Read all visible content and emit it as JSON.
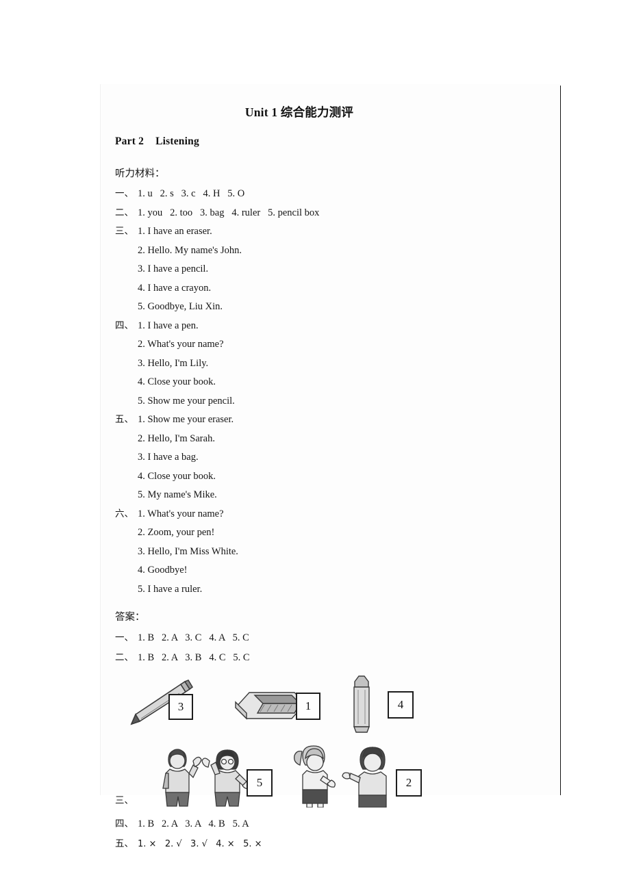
{
  "document": {
    "title": "Unit 1 综合能力测评",
    "part_heading_left": "Part 2",
    "part_heading_right": "Listening",
    "listening_label": "听力材料：",
    "answer_label": "答案："
  },
  "listening": {
    "section1": {
      "marker": "一、",
      "text": "1. u   2. s   3. c   4. H   5. O"
    },
    "section2": {
      "marker": "二、",
      "text": "1. you   2. too   3. bag   4. ruler   5. pencil box"
    },
    "section3": {
      "marker": "三、",
      "items": [
        "1. I have an eraser.",
        "2. Hello. My name's John.",
        "3. I have a pencil.",
        "4. I have a crayon.",
        "5. Goodbye, Liu Xin."
      ]
    },
    "section4": {
      "marker": "四、",
      "items": [
        "1. I have a pen.",
        "2. What's your name?",
        "3. Hello, I'm Lily.",
        "4. Close your book.",
        "5. Show me your pencil."
      ]
    },
    "section5": {
      "marker": "五、",
      "items": [
        "1. Show me your eraser.",
        "2. Hello, I'm Sarah.",
        "3. I have a bag.",
        "4. Close your book.",
        "5. My name's Mike."
      ]
    },
    "section6": {
      "marker": "六、",
      "items": [
        "1. What's your name?",
        "2. Zoom, your pen!",
        "3. Hello, I'm Miss White.",
        "4. Goodbye!",
        "5. I have a ruler."
      ]
    }
  },
  "answers": {
    "section1": {
      "marker": "一、",
      "text": "1. B   2. A   3. C   4. A   5. C"
    },
    "section2": {
      "marker": "二、",
      "text": "1. B   2. A   3. B   4. C   5. C"
    },
    "section3": {
      "marker": "三、",
      "pictures": [
        {
          "id": "pencil",
          "icon": "pencil-icon",
          "box_number": "3"
        },
        {
          "id": "eraser",
          "icon": "eraser-icon",
          "box_number": "1"
        },
        {
          "id": "crayon",
          "icon": "crayon-icon",
          "box_number": "4"
        },
        {
          "id": "two-kids-waving",
          "icon": "children-waving-icon",
          "box_number": "5"
        },
        {
          "id": "girl-and-boy-greeting",
          "icon": "children-greeting-icon",
          "box_number": "2"
        }
      ]
    },
    "section4": {
      "marker": "四、",
      "text": "1. B   2. A   3. A   4. B   5. A"
    },
    "section5": {
      "marker": "五、",
      "text": "1. ×   2. √   3. √   4. ×   5. ×"
    }
  },
  "colors": {
    "page_background": "#fdfdfd",
    "text": "#151515",
    "scan_edge": "#131313",
    "box_border": "#1d1d1d"
  }
}
